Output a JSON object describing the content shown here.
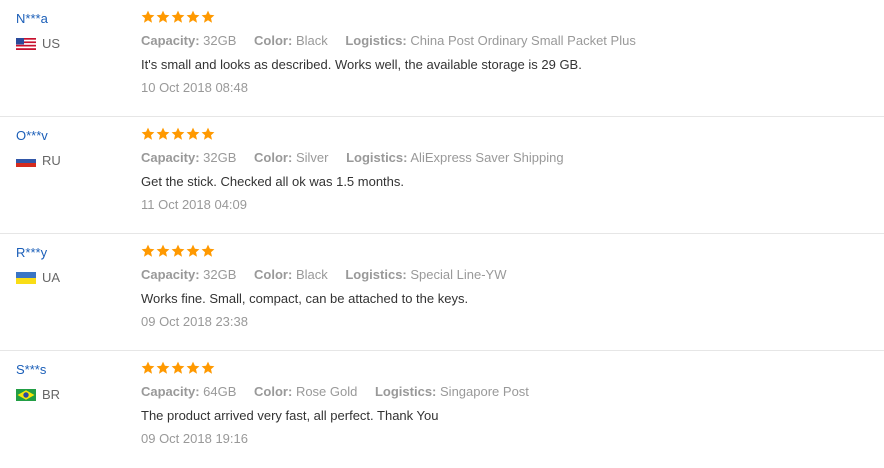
{
  "colors": {
    "star": "#ff9900",
    "username": "#1a5eb8",
    "meta": "#999999",
    "body_text": "#333333"
  },
  "labels": {
    "capacity": "Capacity:",
    "color": "Color:",
    "logistics": "Logistics:"
  },
  "reviews": [
    {
      "user": "N***a",
      "country": "US",
      "rating": 5,
      "capacity": "32GB",
      "color": "Black",
      "logistics": "China Post Ordinary Small Packet Plus",
      "text": "It's small and looks as described. Works well, the available storage is 29 GB.",
      "date": "10 Oct 2018 08:48"
    },
    {
      "user": "O***v",
      "country": "RU",
      "rating": 5,
      "capacity": "32GB",
      "color": "Silver",
      "logistics": "AliExpress Saver Shipping",
      "text": "Get the stick. Checked all ok was 1.5 months.",
      "date": "11 Oct 2018 04:09"
    },
    {
      "user": "R***y",
      "country": "UA",
      "rating": 5,
      "capacity": "32GB",
      "color": "Black",
      "logistics": "Special Line-YW",
      "text": "Works fine. Small, compact, can be attached to the keys.",
      "date": "09 Oct 2018 23:38"
    },
    {
      "user": "S***s",
      "country": "BR",
      "rating": 5,
      "capacity": "64GB",
      "color": "Rose Gold",
      "logistics": "Singapore Post",
      "text": "The product arrived very fast, all perfect. Thank You",
      "date": "09 Oct 2018 19:16"
    }
  ]
}
